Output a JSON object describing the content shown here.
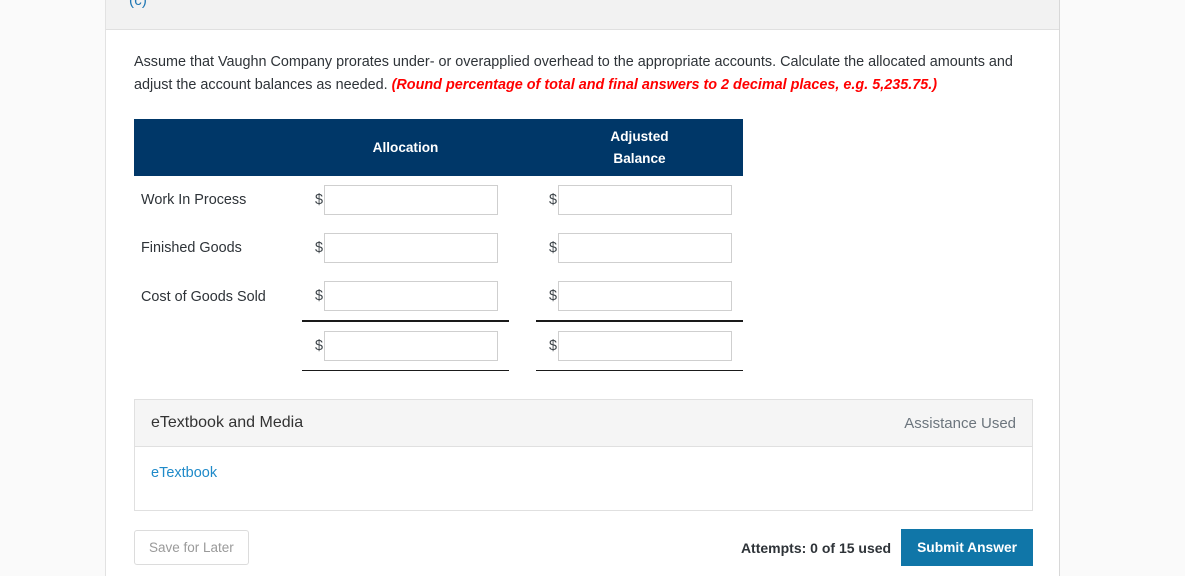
{
  "part_label": "(c)",
  "prompt": {
    "text": "Assume that Vaughn Company prorates under- or overapplied overhead to the appropriate accounts. Calculate the allocated amounts and adjust the account balances as needed. ",
    "note": "(Round percentage of total and final answers to 2 decimal places, e.g. 5,235.75.)"
  },
  "table": {
    "headers": {
      "label": "",
      "allocation": "Allocation",
      "adjusted_balance_line1": "Adjusted",
      "adjusted_balance_line2": "Balance"
    },
    "currency_symbol": "$",
    "rows": [
      {
        "label": "Work In Process",
        "allocation": "",
        "adjusted_balance": ""
      },
      {
        "label": "Finished Goods",
        "allocation": "",
        "adjusted_balance": ""
      },
      {
        "label": "Cost of Goods Sold",
        "allocation": "",
        "adjusted_balance": ""
      },
      {
        "label": "",
        "allocation": "",
        "adjusted_balance": ""
      }
    ]
  },
  "etextbook": {
    "title": "eTextbook and Media",
    "assistance": "Assistance Used",
    "link": "eTextbook"
  },
  "footer": {
    "save_label": "Save for Later",
    "attempts": "Attempts: 0 of 15 used",
    "submit_label": "Submit Answer"
  },
  "colors": {
    "table_header_bg": "#003768",
    "note_red": "#ff0000",
    "link_blue": "#1f8ac9",
    "submit_teal": "#1076a8"
  }
}
